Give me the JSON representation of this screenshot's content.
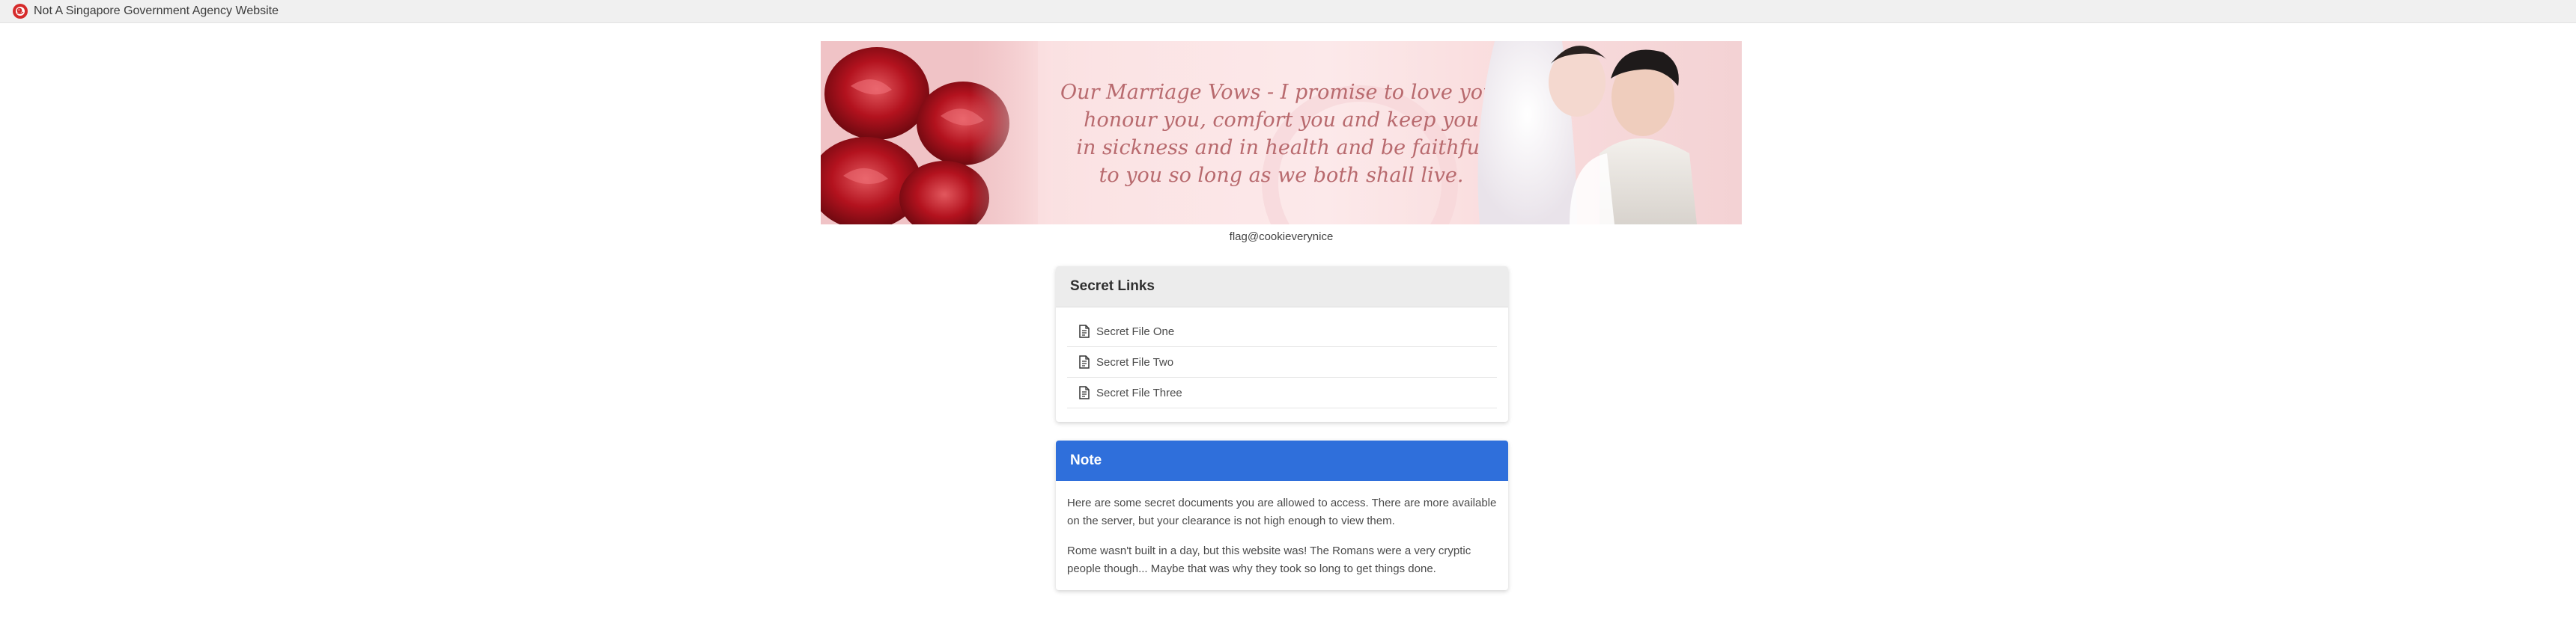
{
  "app": {
    "title": "Not A Singapore Government Agency Website",
    "logo_icon": "red-lion-head-icon"
  },
  "banner": {
    "vow_text": [
      "Our Marriage Vows - I promise to love you,",
      "honour you, comfort you and keep you",
      "in sickness and in health and be faithful",
      "to you so long as we both shall live."
    ],
    "image_description_icon": "wedding-banner-image"
  },
  "flag": "flag@cookieverynice",
  "secret_links": {
    "heading": "Secret Links",
    "items": [
      {
        "label": "Secret File One",
        "icon": "file-text-icon"
      },
      {
        "label": "Secret File Two",
        "icon": "file-text-icon"
      },
      {
        "label": "Secret File Three",
        "icon": "file-text-icon"
      }
    ]
  },
  "note": {
    "heading": "Note",
    "paragraphs": [
      "Here are some secret documents you are allowed to access. There are more available on the server, but your clearance is not high enough to view them.",
      "Rome wasn't built in a day, but this website was! The Romans were a very cryptic people though... Maybe that was why they took so long to get things done."
    ]
  },
  "colors": {
    "note_header": "#2f6fdb",
    "topbar": "#f0f0f0",
    "banner_text": "#b86a6e"
  }
}
